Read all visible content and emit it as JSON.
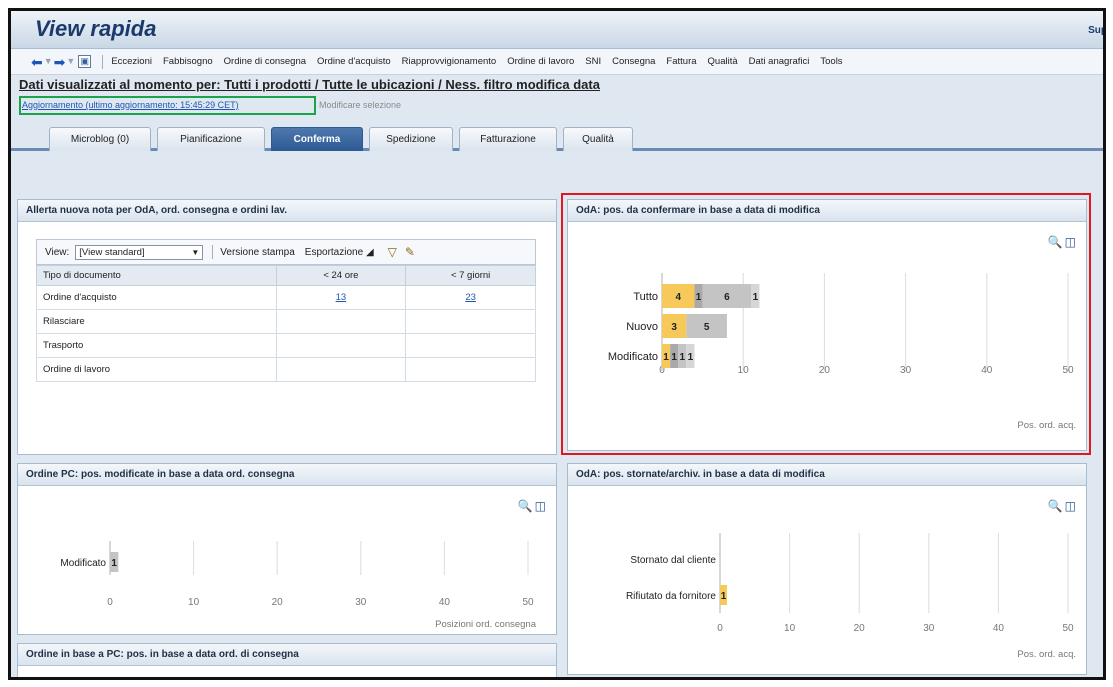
{
  "app": {
    "title": "View rapida",
    "support": "Sup"
  },
  "toolbar": {
    "items": [
      "Eccezioni",
      "Fabbisogno",
      "Ordine di consegna",
      "Ordine d'acquisto",
      "Riapprovvigionamento",
      "Ordine di lavoro",
      "SNI",
      "Consegna",
      "Fattura",
      "Qualità",
      "Dati anagrafici",
      "Tools"
    ]
  },
  "filter": {
    "text": "Dati visualizzati al momento per: Tutti i prodotti / Tutte le ubicazioni / Ness. filtro modifica data",
    "refresh_link": "Aggiornamento (ultimo aggiornamento: 15:45:29 CET)",
    "modify_selection": "Modificare selezione"
  },
  "tabs": [
    {
      "label": "Microblog (0)",
      "active": false
    },
    {
      "label": "Pianificazione",
      "active": false
    },
    {
      "label": "Conferma",
      "active": true
    },
    {
      "label": "Spedizione",
      "active": false
    },
    {
      "label": "Fatturazione",
      "active": false
    },
    {
      "label": "Qualità",
      "active": false
    }
  ],
  "alert_panel": {
    "title": "Allerta nuova nota per OdA, ord. consegna e ordini lav.",
    "view_label": "View:",
    "view_value": "[View standard]",
    "print_version": "Versione stampa",
    "export": "Esportazione",
    "columns": [
      "Tipo di documento",
      "< 24 ore",
      "< 7 giorni"
    ],
    "rows": [
      {
        "type": "Ordine d'acquisto",
        "h24": "13",
        "d7": "23"
      },
      {
        "type": "Rilasciare",
        "h24": "",
        "d7": ""
      },
      {
        "type": "Trasporto",
        "h24": "",
        "d7": ""
      },
      {
        "type": "Ordine di lavoro",
        "h24": "",
        "d7": ""
      }
    ]
  },
  "panels": {
    "oda_confirm": {
      "title": "OdA: pos. da confermare in base a data di modifica"
    },
    "pc_modified": {
      "title": "Ordine PC: pos. modificate in base a data ord. consegna"
    },
    "oda_cancelled": {
      "title": "OdA: pos. stornate/archiv. in base a data di modifica"
    },
    "pc_delivery": {
      "title": "Ordine in base a PC: pos. in base a data ord. di consegna"
    }
  },
  "colors": {
    "accent": "#2b5a94",
    "highlight_red": "#e0171f",
    "highlight_green": "#1aa34a",
    "bar_yellow": "#f6c95a",
    "bar_grey_dark": "#a9a9a9",
    "bar_grey": "#c4c4c4",
    "bar_grey_light": "#d6d6d6"
  },
  "icons": [
    "back-arrow-icon",
    "forward-arrow-icon",
    "page-icon",
    "zoom-icon",
    "export-icon",
    "filter-icon",
    "settings-icon"
  ],
  "chart_data": [
    {
      "id": "oda_confirm",
      "type": "bar",
      "orientation": "horizontal",
      "stacked": true,
      "categories": [
        "Tutto",
        "Nuovo",
        "Modificato"
      ],
      "segments": [
        [
          {
            "value": 4,
            "color": "#f6c95a"
          },
          {
            "value": 1,
            "color": "#a9a9a9"
          },
          {
            "value": 6,
            "color": "#c4c4c4"
          },
          {
            "value": 1,
            "color": "#d6d6d6"
          }
        ],
        [
          {
            "value": 3,
            "color": "#f6c95a"
          },
          {
            "value": 5,
            "color": "#c4c4c4"
          }
        ],
        [
          {
            "value": 1,
            "color": "#f6c95a"
          },
          {
            "value": 1,
            "color": "#a9a9a9"
          },
          {
            "value": 1,
            "color": "#c4c4c4"
          },
          {
            "value": 1,
            "color": "#d6d6d6"
          }
        ]
      ],
      "xlim": [
        0,
        50
      ],
      "ticks": [
        0,
        10,
        20,
        30,
        40,
        50
      ],
      "xlabel": "Pos. ord. acq."
    },
    {
      "id": "pc_modified",
      "type": "bar",
      "orientation": "horizontal",
      "stacked": true,
      "categories": [
        "Modificato"
      ],
      "segments": [
        [
          {
            "value": 1,
            "color": "#c4c4c4"
          }
        ]
      ],
      "xlim": [
        0,
        50
      ],
      "ticks": [
        0,
        10,
        20,
        30,
        40,
        50
      ],
      "xlabel": "Posizioni ord. consegna"
    },
    {
      "id": "oda_cancelled",
      "type": "bar",
      "orientation": "horizontal",
      "stacked": true,
      "categories": [
        "Stornato dal cliente",
        "Rifiutato da fornitore"
      ],
      "segments": [
        [],
        [
          {
            "value": 1,
            "color": "#f6c95a"
          }
        ]
      ],
      "xlim": [
        0,
        50
      ],
      "ticks": [
        0,
        10,
        20,
        30,
        40,
        50
      ],
      "xlabel": "Pos. ord. acq."
    }
  ]
}
